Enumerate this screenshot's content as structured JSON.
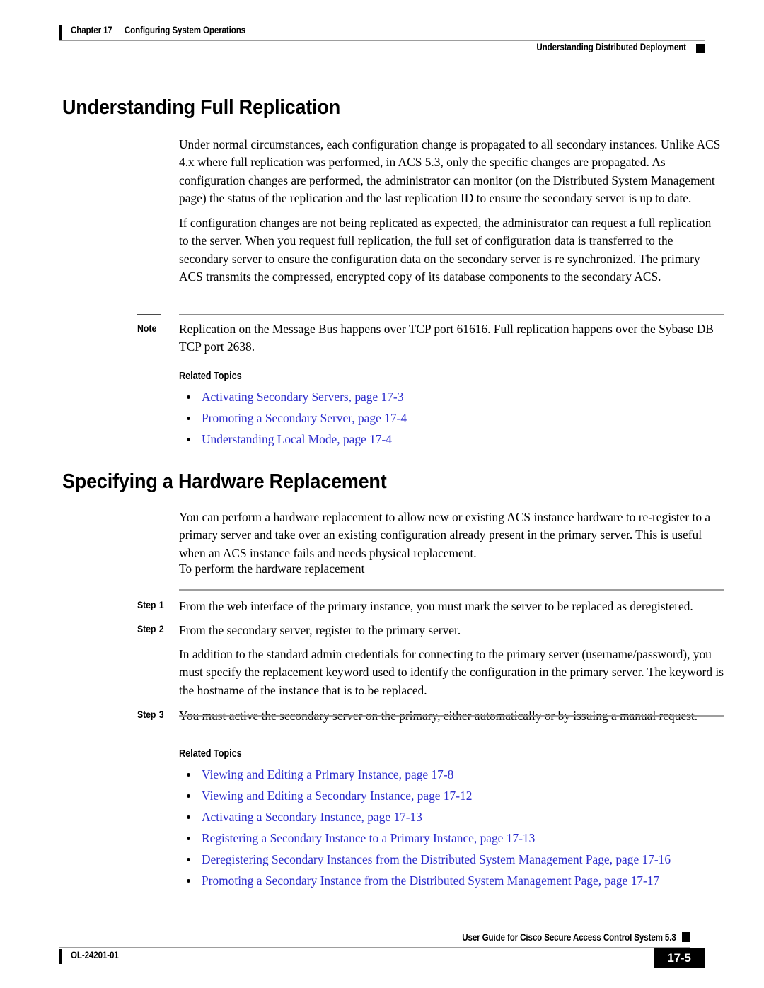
{
  "header": {
    "chapter_label": "Chapter 17",
    "chapter_title": "Configuring System Operations",
    "running_head_right": "Understanding Distributed Deployment"
  },
  "sections": [
    {
      "heading": "Understanding Full Replication",
      "paragraphs": [
        "Under normal circumstances, each configuration change is propagated to all secondary instances. Unlike ACS 4.x where full replication was performed, in ACS 5.3, only the specific changes are propagated. As configuration changes are performed, the administrator can monitor (on the Distributed System Management page) the status of the replication and the last replication ID to ensure the secondary server is up to date.",
        "If configuration changes are not being replicated as expected, the administrator can request a full replication to the server. When you request full replication, the full set of configuration data is transferred to the secondary server to ensure the configuration data on the secondary server is re synchronized. The primary ACS transmits the compressed, encrypted copy of its database components to the secondary ACS."
      ],
      "note": {
        "label": "Note",
        "text": "Replication on the Message Bus happens over TCP port 61616. Full replication happens over the Sybase DB TCP port 2638."
      },
      "related_topics": {
        "heading": "Related Topics",
        "links": [
          "Activating Secondary Servers, page 17-3",
          "Promoting a Secondary Server, page 17-4",
          "Understanding Local Mode, page 17-4"
        ]
      }
    },
    {
      "heading": "Specifying a Hardware Replacement",
      "paragraphs": [
        "You can perform a hardware replacement to allow new or existing ACS instance hardware to re-register to a primary server and take over an existing configuration already present in the primary server. This is useful when an ACS instance fails and needs physical replacement.",
        "To perform the hardware replacement"
      ],
      "steps": [
        {
          "label": "Step",
          "number": "1",
          "text": "From the web interface of the primary instance, you must mark the server to be replaced as deregistered."
        },
        {
          "label": "Step",
          "number": "2",
          "text": "From the secondary server, register to the primary server."
        },
        {
          "label": "",
          "number": "",
          "text": "In addition to the standard admin credentials for connecting to the primary server (username/password), you must specify the replacement keyword used to identify the configuration in the primary server. The keyword is the hostname of the instance that is to be replaced."
        },
        {
          "label": "Step",
          "number": "3",
          "text": "You must active the secondary server on the primary, either automatically or by issuing a manual request."
        }
      ],
      "related_topics": {
        "heading": "Related Topics",
        "links": [
          "Viewing and Editing a Primary Instance, page 17-8",
          "Viewing and Editing a Secondary Instance, page 17-12",
          "Activating a Secondary Instance, page 17-13",
          "Registering a Secondary Instance to a Primary Instance, page 17-13",
          "Deregistering Secondary Instances from the Distributed System Management Page, page 17-16",
          "Promoting a Secondary Instance from the Distributed System Management Page, page 17-17"
        ]
      }
    }
  ],
  "footer": {
    "guide_title": "User Guide for Cisco Secure Access Control System 5.3",
    "doc_id": "OL-24201-01",
    "page_number": "17-5"
  },
  "colors": {
    "link": "#2c2ccc",
    "rule": "#9d9d9d",
    "text": "#000000",
    "page_box": "#000000"
  }
}
